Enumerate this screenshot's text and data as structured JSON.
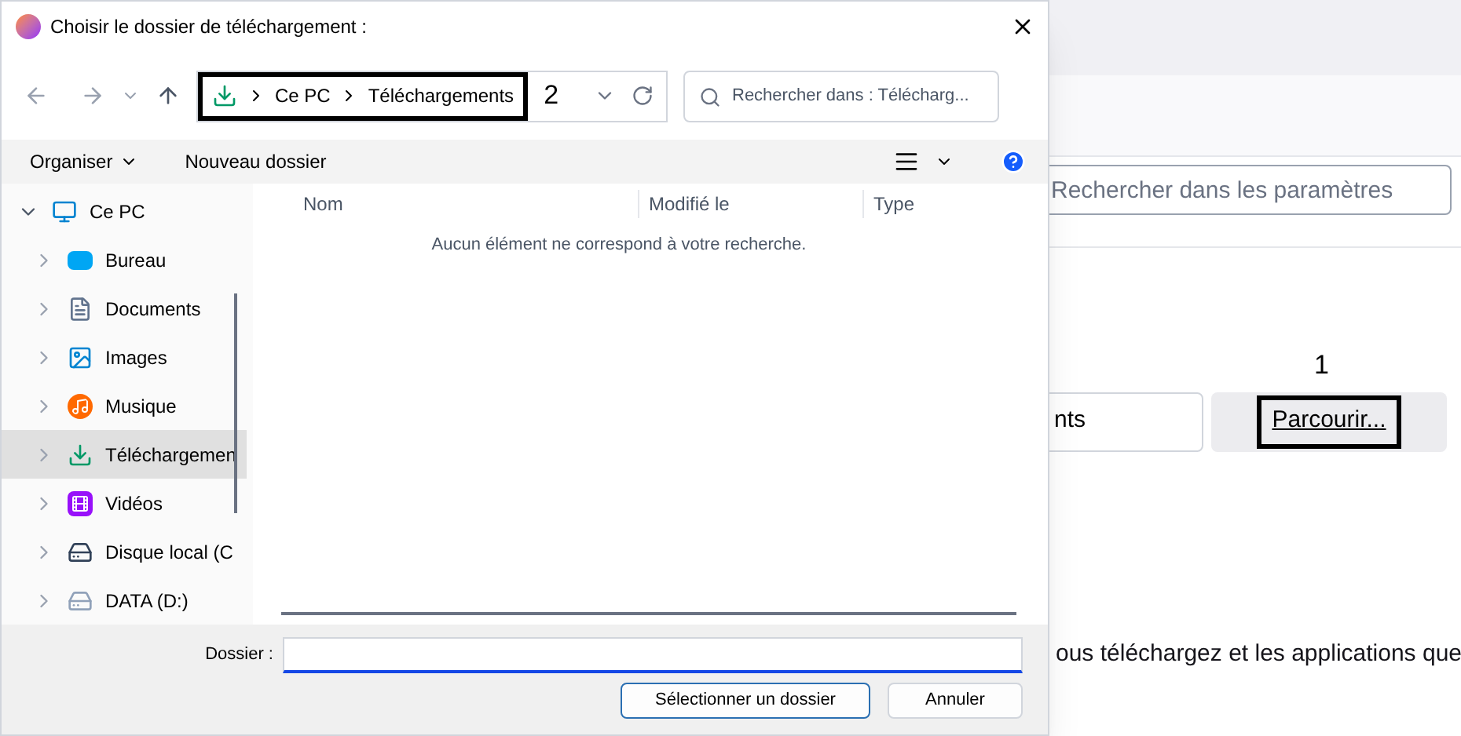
{
  "dialog": {
    "title": "Choisir le dossier de téléchargement :",
    "breadcrumb": [
      "Ce PC",
      "Téléchargements"
    ],
    "annotation": "2",
    "search": {
      "placeholder": "Rechercher dans : Télécharg..."
    },
    "toolbar": [
      "Organiser",
      "Nouveau dossier"
    ],
    "tree": [
      {
        "label": "Ce PC",
        "kind": "pc",
        "expanded": true,
        "selected": false,
        "children": [
          {
            "label": "Bureau",
            "kind": "desktop",
            "selected": false
          },
          {
            "label": "Documents",
            "kind": "docs",
            "selected": false
          },
          {
            "label": "Images",
            "kind": "images",
            "selected": false
          },
          {
            "label": "Musique",
            "kind": "music",
            "selected": false
          },
          {
            "label": "Téléchargemen",
            "kind": "download",
            "selected": true
          },
          {
            "label": "Vidéos",
            "kind": "video",
            "selected": false
          },
          {
            "label": "Disque local (C",
            "kind": "drive",
            "selected": false
          },
          {
            "label": "DATA (D:)",
            "kind": "drive2",
            "selected": false
          }
        ]
      }
    ],
    "columns": [
      "Nom",
      "Modifié le",
      "Type"
    ],
    "empty_message": "Aucun élément ne correspond à votre recherche.",
    "folder_label": "Dossier :",
    "buttons": [
      "Sélectionner un dossier",
      "Annuler"
    ]
  },
  "background": {
    "search": {
      "placeholder": "Rechercher dans les paramètres"
    },
    "annotation": "1",
    "field_value": "nts",
    "browse_button": "Parcourir...",
    "text": "ous téléchargez et les applications que"
  }
}
